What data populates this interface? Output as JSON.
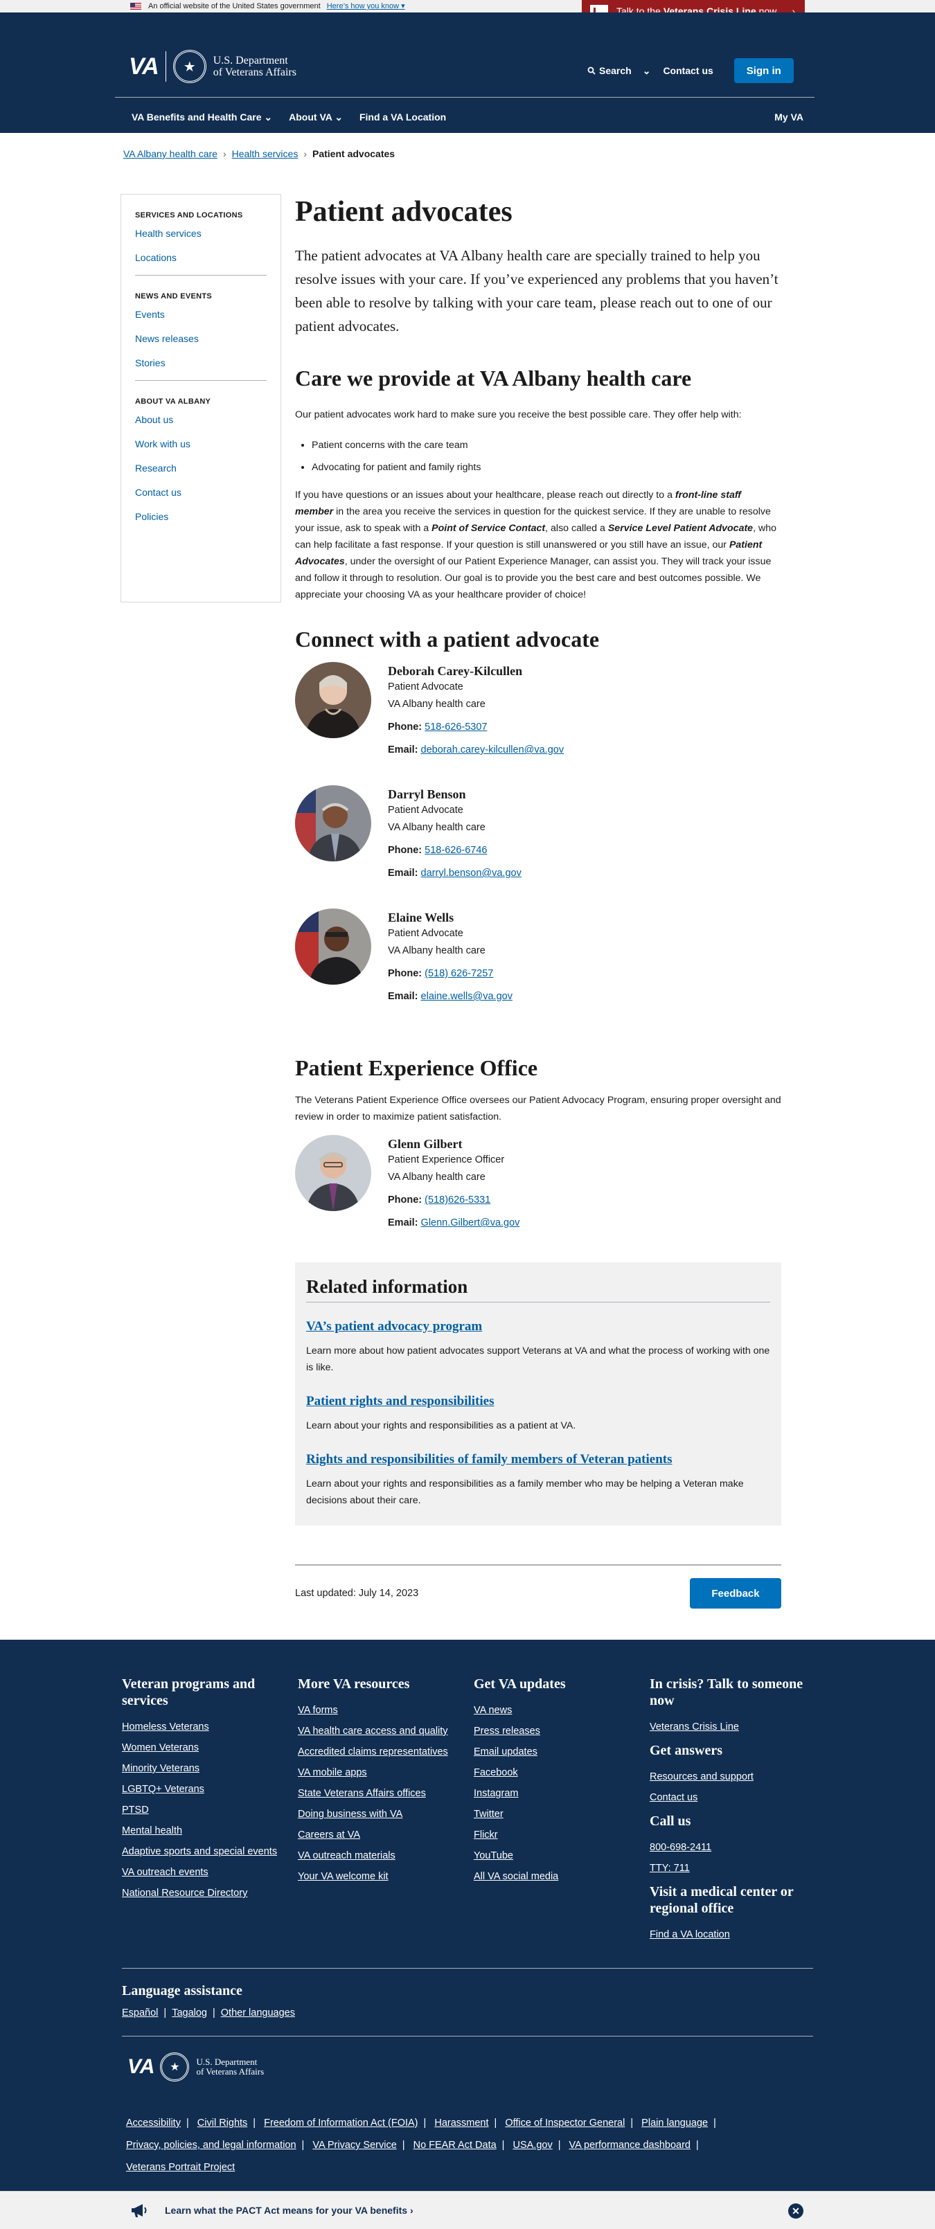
{
  "banner": {
    "official": "An official website of the United States government",
    "how_know": "Here’s how you know",
    "crisis_prefix": "Talk to the",
    "crisis_bold": "Veterans Crisis Line",
    "crisis_suffix": "now"
  },
  "header": {
    "logo": "VA",
    "dept_line1": "U.S. Department",
    "dept_line2": "of Veterans Affairs",
    "search": "Search",
    "contact": "Contact us",
    "signin": "Sign in"
  },
  "menu": {
    "benefits": "VA Benefits and Health Care",
    "about": "About VA",
    "find": "Find a VA Location",
    "myva": "My VA"
  },
  "breadcrumb": {
    "item1": "VA Albany health care",
    "item2": "Health services",
    "current": "Patient advocates"
  },
  "sidebar": {
    "sec1": "SERVICES AND LOCATIONS",
    "sec1_items": [
      "Health services",
      "Locations"
    ],
    "sec2": "NEWS AND EVENTS",
    "sec2_items": [
      "Events",
      "News releases",
      "Stories"
    ],
    "sec3": "ABOUT VA ALBANY",
    "sec3_items": [
      "About us",
      "Work with us",
      "Research",
      "Contact us",
      "Policies"
    ]
  },
  "main": {
    "title": "Patient advocates",
    "intro": "The patient advocates at VA Albany health care are specially trained to help you resolve issues with your care. If you’ve experienced any problems that you haven’t been able to resolve by talking with your care team, please reach out to one of our patient advocates.",
    "care_heading": "Care we provide at VA Albany health care",
    "care_text": "Our patient advocates work hard to make sure you receive the best possible care. They offer help with:",
    "bullets": [
      "Patient concerns with the care team",
      "Advocating for patient and family rights"
    ],
    "p1": "If you have questions or an issues about your healthcare, please reach out directly to a ",
    "p1_b1": "front-line staff member",
    "p2": " in the area you receive the services in question for the quickest service.  If they are unable to resolve your issue, ask to speak with a ",
    "p2_b": "Point of Service Contact",
    "p3": ", also called a ",
    "p3_b": "Service Level Patient Advocate",
    "p4": ", who can  help facilitate a fast response.  If your question is still unanswered or you still have an issue, our ",
    "p4_b": "Patient Advocates",
    "p5": ", under the oversight of our Patient Experience Manager, can assist you.  They will track your issue and follow it through to resolution.  Our goal is to provide you the best care and best outcomes possible.  We appreciate your choosing VA as your healthcare provider of choice!",
    "connect_heading": "Connect with a patient advocate",
    "phone_label": "Phone:",
    "email_label": "Email:",
    "people": [
      {
        "name": "Deborah Carey-Kilcullen",
        "role": "Patient Advocate",
        "org": "VA Albany health care",
        "phone": "518-626-5307",
        "email": "deborah.carey-kilcullen@va.gov"
      },
      {
        "name": "Darryl Benson",
        "role": "Patient Advocate",
        "org": "VA Albany health care",
        "phone": "518-626-6746",
        "email": "darryl.benson@va.gov"
      },
      {
        "name": "Elaine Wells",
        "role": "Patient Advocate",
        "org": "VA Albany health care",
        "phone": "(518) 626-7257",
        "email": "elaine.wells@va.gov"
      }
    ],
    "pxo_heading": "Patient Experience Office",
    "pxo_text": "The Veterans Patient Experience Office oversees our Patient Advocacy Program, ensuring proper oversight and review in order to maximize patient satisfaction.",
    "pxo_person": {
      "name": "Glenn Gilbert",
      "role": "Patient Experience Officer",
      "org": "VA Albany health care",
      "phone": "(518)626-5331",
      "email": "Glenn.Gilbert@va.gov"
    },
    "related_heading": "Related information",
    "related": [
      {
        "title": "VA’s patient advocacy program",
        "desc": "Learn more about how patient advocates support Veterans at VA and what the process of working with one is like."
      },
      {
        "title": "Patient rights and responsibilities",
        "desc": "Learn about your rights and responsibilities as a patient at VA."
      },
      {
        "title": "Rights and responsibilities of family members of Veteran patients",
        "desc": "Learn about your rights and responsibilities as a family member who may be helping a Veteran make decisions about their care."
      }
    ],
    "last_updated": "Last updated: July 14, 2023",
    "feedback": "Feedback"
  },
  "footer": {
    "col1_title": "Veteran programs and services",
    "col1": [
      "Homeless Veterans",
      "Women Veterans",
      "Minority Veterans",
      "LGBTQ+ Veterans",
      "PTSD",
      "Mental health",
      "Adaptive sports and special events",
      "VA outreach events",
      "National Resource Directory"
    ],
    "col2_title": "More VA resources",
    "col2": [
      "VA forms",
      "VA health care access and quality",
      "Accredited claims representatives",
      "VA mobile apps",
      "State Veterans Affairs offices",
      "Doing business with VA",
      "Careers at VA",
      "VA outreach materials",
      "Your VA welcome kit"
    ],
    "col3_title": "Get VA updates",
    "col3": [
      "VA news",
      "Press releases",
      "Email updates",
      "Facebook",
      "Instagram",
      "Twitter",
      "Flickr",
      "YouTube",
      "All VA social media"
    ],
    "col4_title1": "In crisis? Talk to someone now",
    "col4_link1": "Veterans Crisis Line",
    "col4_title2": "Get answers",
    "col4_links2": [
      "Resources and support",
      "Contact us"
    ],
    "col4_title3": "Call us",
    "col4_links3": [
      "800-698-2411",
      "TTY: 711"
    ],
    "col4_title4": "Visit a medical center or regional office",
    "col4_link4": "Find a VA location",
    "lang_title": "Language assistance",
    "lang": [
      "Español",
      "Tagalog",
      "Other languages"
    ],
    "bottom_links": [
      "Accessibility",
      "Civil Rights",
      "Freedom of Information Act (FOIA)",
      "Harassment",
      "Office of Inspector General",
      "Plain language",
      "Privacy, policies, and legal information",
      "VA Privacy Service",
      "No FEAR Act Data",
      "USA.gov",
      "VA performance dashboard",
      "Veterans Portrait Project"
    ]
  },
  "pact": {
    "text": "Learn what the PACT Act means for your VA benefits"
  }
}
